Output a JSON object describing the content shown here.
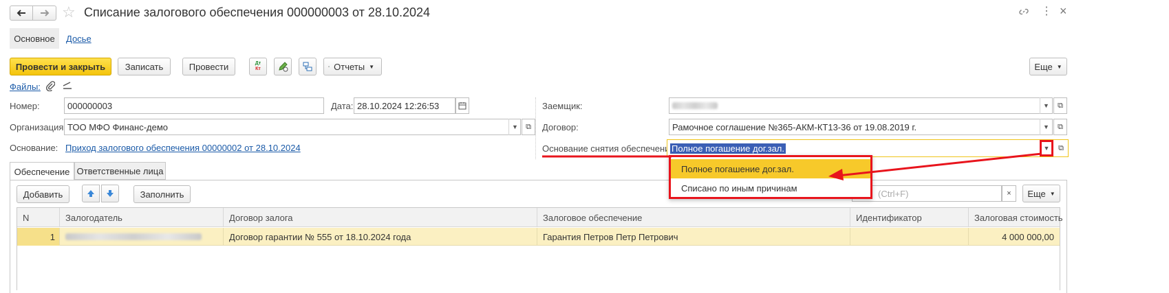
{
  "window": {
    "title": "Списание залогового обеспечения 000000003 от 28.10.2024"
  },
  "tabs_top": {
    "main": "Основное",
    "dossier": "Досье"
  },
  "toolbar": {
    "post_and_close": "Провести и закрыть",
    "save": "Записать",
    "post": "Провести",
    "dtkt_icon_text": "Дт Кт",
    "reports": "Отчеты",
    "more": "Еще"
  },
  "files": {
    "label": "Файлы:"
  },
  "form": {
    "number_label": "Номер:",
    "number_value": "000000003",
    "date_label": "Дата:",
    "date_value": "28.10.2024 12:26:53",
    "org_label": "Организация:",
    "org_value": "ТОО МФО Финанс-демо",
    "basis_label": "Основание:",
    "basis_value": "Приход залогового обеспечения 00000002 от 28.10.2024",
    "borrower_label": "Заемщик:",
    "contract_label": "Договор:",
    "contract_value": "Рамочное соглашение №365-АКМ-КТ13-36 от 19.08.2019 г.",
    "release_basis_label": "Основание снятия обеспечения:",
    "release_basis_value": "Полное погашение дог.зал."
  },
  "dropdown": {
    "options": [
      "Полное погашение дог.зал.",
      "Списано по иным причинам"
    ]
  },
  "section_tabs": {
    "collateral": "Обеспечение",
    "responsible": "Ответственные лица"
  },
  "table_toolbar": {
    "add": "Добавить",
    "fill": "Заполнить",
    "search_placeholder": "(Ctrl+F)",
    "clear": "×",
    "more": "Еще"
  },
  "table": {
    "columns": [
      "N",
      "Залогодатель",
      "Договор залога",
      "Залоговое обеспечение",
      "Идентификатор",
      "Залоговая стоимость"
    ],
    "rows": [
      {
        "n": "1",
        "pledgor": "",
        "pledge_contract": "Договор гарантии № 555 от 18.10.2024 года",
        "collateral": "Гарантия Петров Петр Петрович",
        "identifier": "",
        "value": "4 000 000,00"
      }
    ]
  },
  "colors": {
    "accent_yellow": "#f4c40c",
    "annotation_red": "#e8141c",
    "link_blue": "#1a5aa8",
    "row_highlight": "#fbf0c2"
  }
}
